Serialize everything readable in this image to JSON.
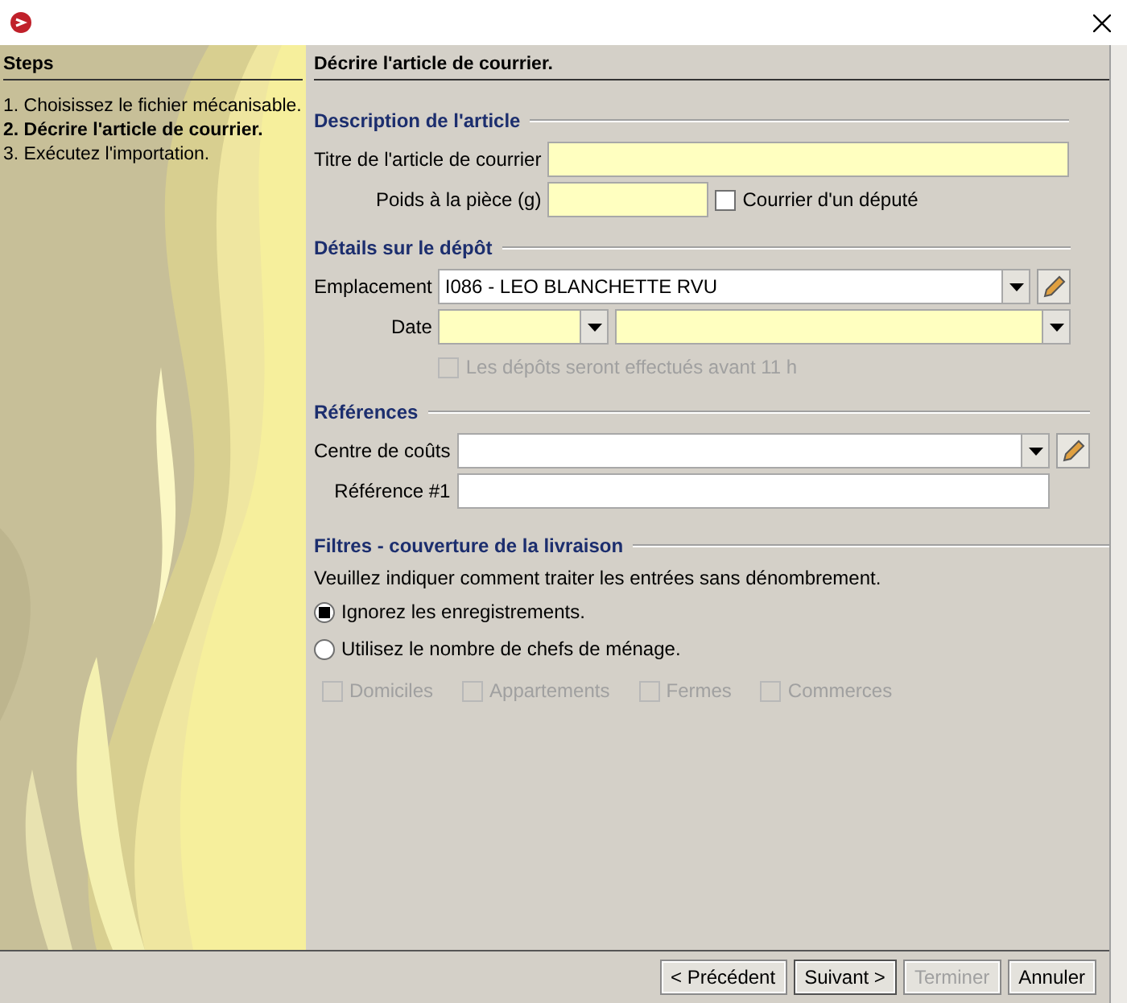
{
  "steps": {
    "title": "Steps",
    "items": [
      {
        "label": "1. Choisissez le fichier mécanisable.",
        "selected": false
      },
      {
        "label": "2. Décrire l'article de courrier.",
        "selected": true
      },
      {
        "label": "3. Exécutez l'importation.",
        "selected": false
      }
    ]
  },
  "page": {
    "heading": "Décrire l'article de courrier."
  },
  "description": {
    "title": "Description de l'article",
    "item_title": {
      "label": "Titre de l'article de courrier"
    },
    "weight": {
      "label": "Poids à la pièce (g)"
    },
    "mp_mail": {
      "label": "Courrier d'un député",
      "checked": false
    }
  },
  "deposit": {
    "title": "Détails sur le dépôt",
    "location": {
      "label": "Emplacement",
      "value": "I086 - LEO BLANCHETTE RVU"
    },
    "date": {
      "label": "Date"
    },
    "before_11": {
      "label": "Les dépôts seront effectués avant 11 h",
      "checked": false,
      "disabled": true
    }
  },
  "references": {
    "title": "Références",
    "cost_centre": {
      "label": "Centre de coûts"
    },
    "reference_1": {
      "label": "Référence #1"
    }
  },
  "filters": {
    "title": "Filtres - couverture de la livraison",
    "instruction": "Veuillez indiquer comment traiter les entrées sans dénombrement.",
    "options": [
      {
        "label": "Ignorez les enregistrements.",
        "selected": true
      },
      {
        "label": "Utilisez le nombre de chefs de ménage.",
        "selected": false
      }
    ],
    "types": [
      {
        "label": "Domiciles",
        "checked": false,
        "disabled": true
      },
      {
        "label": "Appartements",
        "checked": false,
        "disabled": true
      },
      {
        "label": "Fermes",
        "checked": false,
        "disabled": true
      },
      {
        "label": "Commerces",
        "checked": false,
        "disabled": true
      }
    ]
  },
  "buttons": [
    {
      "label": "< Précédent",
      "disabled": false
    },
    {
      "label": "Suivant >",
      "disabled": false,
      "default": true
    },
    {
      "label": "Terminer",
      "disabled": true
    },
    {
      "label": "Annuler",
      "disabled": false
    }
  ]
}
